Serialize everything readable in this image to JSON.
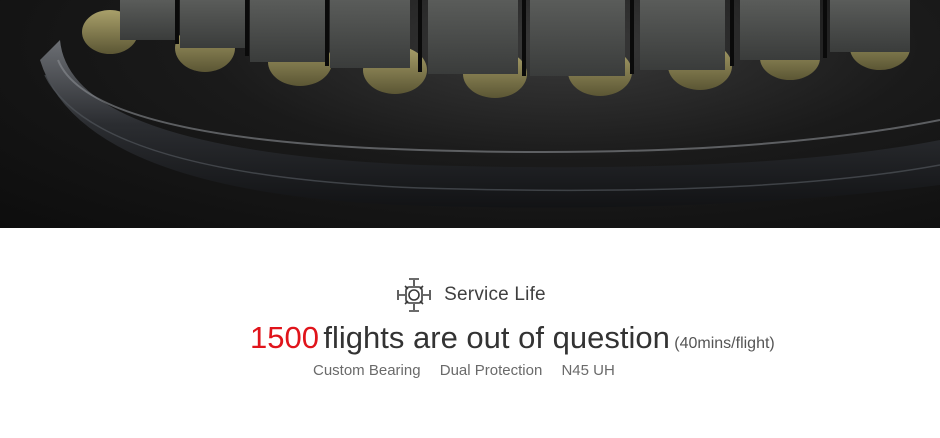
{
  "hero": {
    "image": "motor-stator-closeup"
  },
  "title": {
    "icon": "drone-icon",
    "text": "Service Life"
  },
  "headline": {
    "number": "1500",
    "text": "flights are out of question",
    "note": "(40mins/flight)"
  },
  "features": [
    "Custom Bearing",
    "Dual Protection",
    "N45 UH"
  ],
  "colors": {
    "accent": "#e0141b",
    "text": "#333333",
    "muted": "#6a6a6a"
  }
}
